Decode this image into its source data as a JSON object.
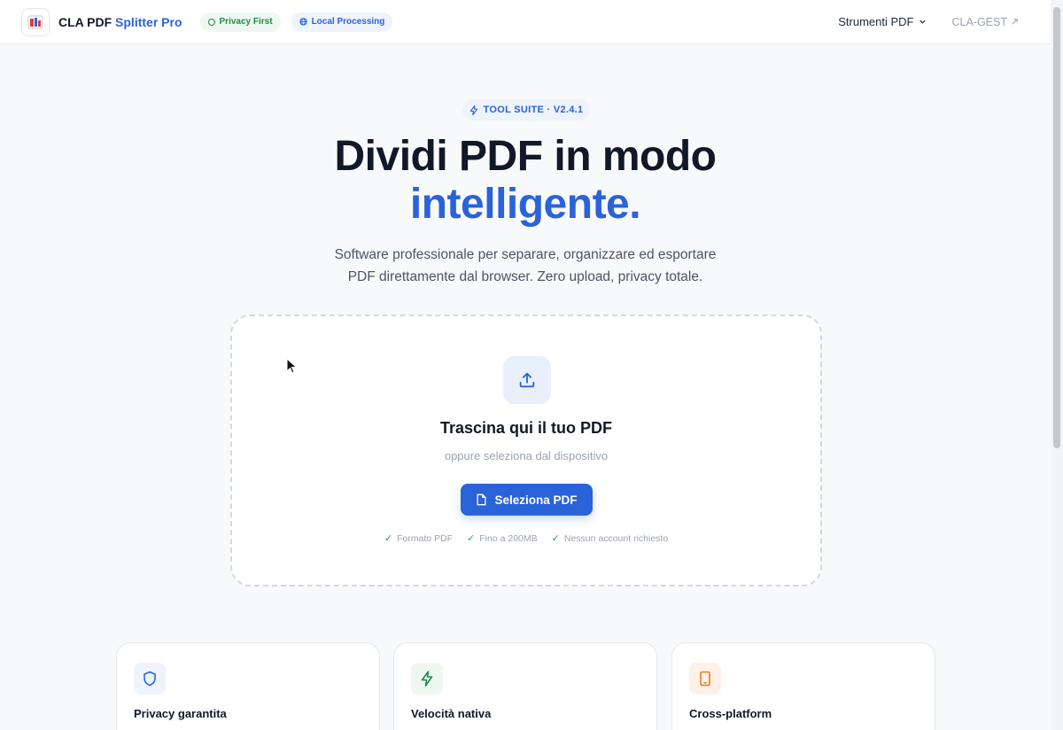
{
  "header": {
    "brand_main": "CLA PDF",
    "brand_accent": "Splitter Pro",
    "pill_privacy": "Privacy First",
    "pill_local": "Local Processing",
    "nav_tools": "Strumenti PDF",
    "nav_link": "CLA-GEST"
  },
  "hero": {
    "badge": "TOOL SUITE · V2.4.1",
    "title_line1": "Dividi PDF in modo",
    "title_line2": "intelligente.",
    "subtitle_line1": "Software professionale per separare, organizzare ed esportare",
    "subtitle_line2": "PDF direttamente dal browser. Zero upload, privacy totale."
  },
  "dropzone": {
    "title": "Trascina qui il tuo PDF",
    "subtitle": "oppure seleziona dal dispositivo",
    "button": "Seleziona PDF",
    "features": [
      "Formato PDF",
      "Fino a 200MB",
      "Nessun account richiesto"
    ]
  },
  "cards": [
    {
      "title": "Privacy garantita",
      "icon": "shield-icon",
      "color": "#2a63d9"
    },
    {
      "title": "Velocità nativa",
      "icon": "bolt-icon",
      "color": "#1f8a4c"
    },
    {
      "title": "Cross-platform",
      "icon": "phone-icon",
      "color": "#ea7a1a"
    }
  ],
  "colors": {
    "accent": "#2a63d9",
    "success": "#22a35a"
  }
}
